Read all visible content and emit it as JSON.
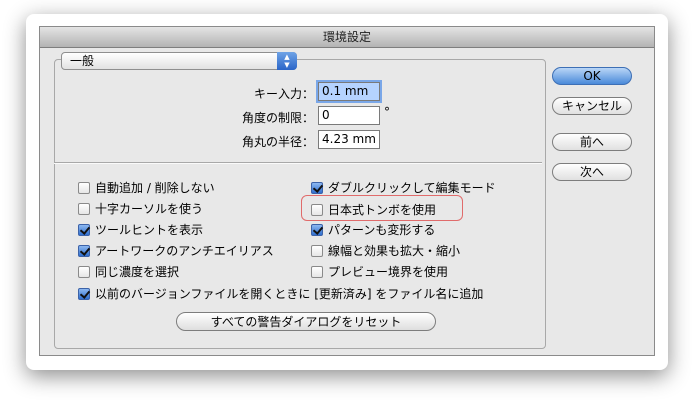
{
  "window": {
    "title": "環境設定"
  },
  "popup": {
    "value": "一般"
  },
  "fields": {
    "key_input_label": "キー入力：",
    "key_input_value": "0.1 mm",
    "angle_limit_label": "角度の制限：",
    "angle_limit_value": "0",
    "angle_unit": "°",
    "corner_radius_label": "角丸の半径：",
    "corner_radius_value": "4.23 mm"
  },
  "options": {
    "auto_add_delete": {
      "label": "自動追加 / 削除しない",
      "checked": false
    },
    "cross_cursor": {
      "label": "十字カーソルを使う",
      "checked": false
    },
    "tool_tips": {
      "label": "ツールヒントを表示",
      "checked": true
    },
    "antialias_artwork": {
      "label": "アートワークのアンチエイリアス",
      "checked": true
    },
    "same_density": {
      "label": "同じ濃度を選択",
      "checked": false
    },
    "legacy_files": {
      "label": "以前のバージョンファイルを開くときに [更新済み] をファイル名に追加",
      "checked": true
    },
    "double_click_edit": {
      "label": "ダブルクリックして編集モード",
      "checked": true
    },
    "japanese_crop_marks": {
      "label": "日本式トンボを使用",
      "checked": false
    },
    "transform_patterns": {
      "label": "パターンも変形する",
      "checked": true
    },
    "scale_strokes": {
      "label": "線幅と効果も拡大・縮小",
      "checked": false
    },
    "preview_bounds": {
      "label": "プレビュー境界を使用",
      "checked": false
    }
  },
  "buttons": {
    "ok": "OK",
    "cancel": "キャンセル",
    "prev": "前へ",
    "next": "次へ",
    "reset_warnings": "すべての警告ダイアログをリセット"
  },
  "colors": {
    "accent": "#2f6fcf",
    "highlight": "#e06b6b"
  }
}
